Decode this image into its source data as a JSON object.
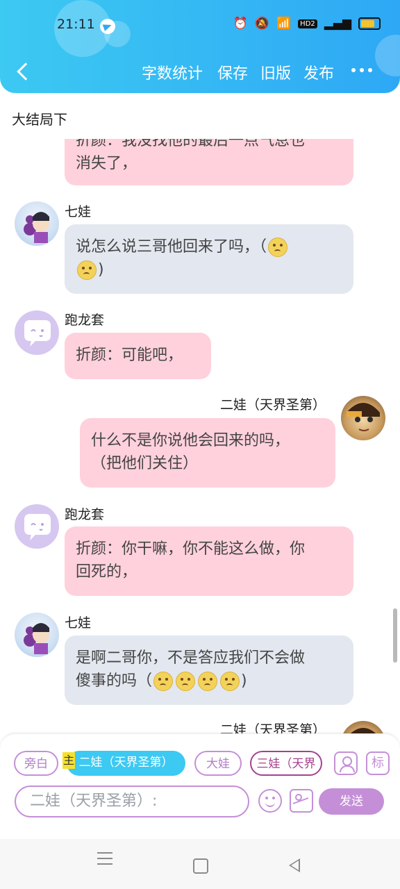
{
  "status_bar": {
    "time": "21:11",
    "icons": [
      "alarm-icon",
      "mute-icon",
      "wifi-icon",
      "hd2-icon",
      "signal-icon",
      "4g-signal-icon",
      "battery-icon"
    ],
    "hd_label": "HD2"
  },
  "header": {
    "actions": [
      "字数统计",
      "保存",
      "旧版",
      "发布"
    ],
    "colors": {
      "gradient_start": "#3cc9f2",
      "gradient_end": "#2ea8f5"
    }
  },
  "page_title": "大结局下",
  "messages": [
    {
      "sender": "",
      "side": "left",
      "bubble": "pink",
      "lines": [
        "折颜：我没找他的最后一点气息也",
        "消失了，"
      ],
      "partial": true
    },
    {
      "sender": "七娃",
      "side": "left",
      "bubble": "gray",
      "avatar": "qiwa-avatar",
      "lines": [
        "说怎么说三哥他回来了吗，（",
        ")"
      ]
    },
    {
      "sender": "跑龙套",
      "side": "left",
      "bubble": "pink",
      "avatar": "ghost-avatar",
      "lines": [
        "折颜：可能吧，"
      ]
    },
    {
      "sender": "二娃（天界圣第）",
      "side": "right",
      "bubble": "pink",
      "avatar": "erwa-avatar",
      "lines": [
        "什么不是你说他会回来的吗，",
        "（把他们关住）"
      ]
    },
    {
      "sender": "跑龙套",
      "side": "left",
      "bubble": "pink",
      "avatar": "ghost-avatar",
      "lines": [
        "折颜：你干嘛，你不能这么做，你",
        "回死的，"
      ]
    },
    {
      "sender": "七娃",
      "side": "left",
      "bubble": "gray",
      "avatar": "qiwa-avatar",
      "lines": [
        "是啊二哥你，不是答应我们不会做",
        "傻事的吗（",
        ")"
      ]
    },
    {
      "sender": "二娃（天界圣第）",
      "side": "right",
      "avatar": "erwa-avatar",
      "partial": true
    }
  ],
  "role_chips": {
    "narration": "旁白",
    "main_badge": "主",
    "active": "二娃（天界圣第）",
    "dawa": "大娃",
    "sanwa": "三娃（天界",
    "tag_button": "标"
  },
  "input": {
    "placeholder": "二娃（天界圣第）:",
    "send_label": "发送"
  },
  "accent_colors": {
    "chip_border": "#c58fd8",
    "active_chip": "#3cc9f2",
    "pink_bubble": "#ffd1dc",
    "gray_bubble": "#e3e7ef"
  }
}
